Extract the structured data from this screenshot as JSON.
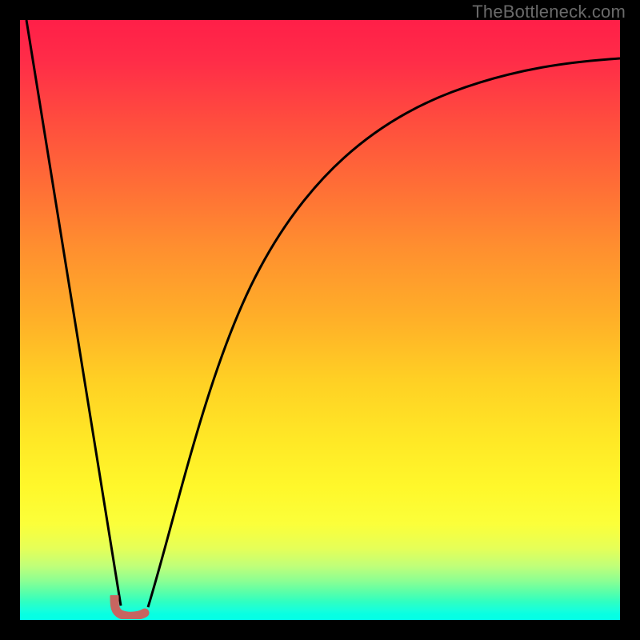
{
  "watermark": "TheBottleneck.com",
  "chart_data": {
    "type": "line",
    "title": "",
    "xlabel": "",
    "ylabel": "",
    "xlim": [
      0,
      100
    ],
    "ylim": [
      0,
      100
    ],
    "grid": false,
    "legend": false,
    "series": [
      {
        "name": "descending-line",
        "x": [
          0,
          16
        ],
        "y": [
          100,
          2
        ]
      },
      {
        "name": "ascending-curve",
        "x": [
          20,
          26,
          32,
          40,
          50,
          62,
          76,
          90,
          100
        ],
        "y": [
          2,
          18,
          35,
          52,
          66,
          77,
          85,
          90.5,
          92.5
        ]
      }
    ],
    "dip_highlight": {
      "x": 17.5,
      "label": "J-shaped dip marker"
    },
    "gradient_bands": [
      {
        "pct": 0,
        "color": "#ff1f48"
      },
      {
        "pct": 50,
        "color": "#ffb028"
      },
      {
        "pct": 78,
        "color": "#fff82b"
      },
      {
        "pct": 100,
        "color": "#04ffe6"
      }
    ]
  }
}
